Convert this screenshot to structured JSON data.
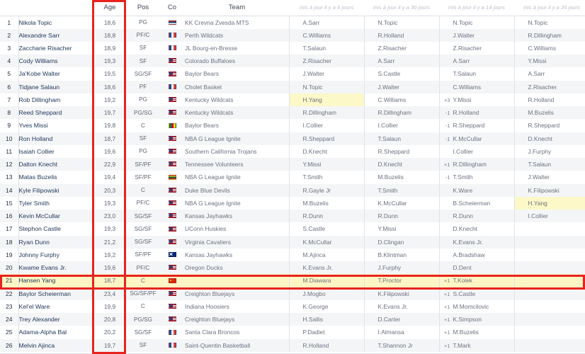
{
  "table": {
    "headers": {
      "rank": "",
      "name": "",
      "age": "Age",
      "pos": "Pos",
      "co": "Co",
      "team": "Team",
      "hist1": "mis à jour il y a 6 jours",
      "hist2": "mis à jour il y a 30 jours",
      "hist3": "mis à jour il y a 14 jours",
      "hist4": "mis à jour il y a 20 jours"
    },
    "highlight_color": "#fdf6c4",
    "annotation_color": "#e8231f",
    "rows": [
      {
        "rank": "1",
        "name": "Nikola Topic",
        "age": "18,6",
        "pos": "PG",
        "flag": "srb",
        "team": "KK Crevna Zvesda MTS",
        "h1": {
          "d": "",
          "p": "A.Sarr"
        },
        "h2": {
          "d": "",
          "p": "N.Topic"
        },
        "h3": {
          "d": "",
          "p": "N.Topic"
        },
        "h4": {
          "d": "",
          "p": "N.Topic"
        }
      },
      {
        "rank": "2",
        "name": "Alexandre Sarr",
        "age": "18,8",
        "pos": "PF/C",
        "flag": "fra",
        "team": "Perth Wildcats",
        "h1": {
          "d": "",
          "p": "C.Williams"
        },
        "h2": {
          "d": "",
          "p": "R.Holland"
        },
        "h3": {
          "d": "",
          "p": "J.Walter"
        },
        "h4": {
          "d": "",
          "p": "R.Dillingham"
        }
      },
      {
        "rank": "3",
        "name": "Zaccharie Risacher",
        "age": "18,9",
        "pos": "SF",
        "flag": "fra",
        "team": "JL Bourg-en-Bresse",
        "h1": {
          "d": "",
          "p": "T.Salaun"
        },
        "h2": {
          "d": "",
          "p": "Z.Risacher"
        },
        "h3": {
          "d": "",
          "p": "Z.Risacher"
        },
        "h4": {
          "d": "",
          "p": "C.Williams"
        }
      },
      {
        "rank": "4",
        "name": "Cody Williams",
        "age": "19,3",
        "pos": "SF",
        "flag": "usa",
        "team": "Colorado Buffaloes",
        "h1": {
          "d": "",
          "p": "Z.Risacher"
        },
        "h2": {
          "d": "",
          "p": "A.Sarr"
        },
        "h3": {
          "d": "",
          "p": "A.Sarr"
        },
        "h4": {
          "d": "",
          "p": "Y.Missi"
        }
      },
      {
        "rank": "5",
        "name": "Ja'Kobe Walter",
        "age": "19,5",
        "pos": "SG/SF",
        "flag": "usa",
        "team": "Baylor Bears",
        "h1": {
          "d": "",
          "p": "J.Walter"
        },
        "h2": {
          "d": "",
          "p": "S.Castle"
        },
        "h3": {
          "d": "",
          "p": "T.Salaun"
        },
        "h4": {
          "d": "",
          "p": "A.Sarr"
        }
      },
      {
        "rank": "6",
        "name": "Tidjane Salaun",
        "age": "18,6",
        "pos": "PF",
        "flag": "fra",
        "team": "Cholet Basket",
        "h1": {
          "d": "",
          "p": "N.Topic"
        },
        "h2": {
          "d": "",
          "p": "J.Walter"
        },
        "h3": {
          "d": "",
          "p": "C.Williams"
        },
        "h4": {
          "d": "",
          "p": "Z.Risacher"
        }
      },
      {
        "rank": "7",
        "name": "Rob Dillingham",
        "age": "19,2",
        "pos": "PG",
        "flag": "usa",
        "team": "Kentucky Wildcats",
        "h1": {
          "d": "",
          "p": "H.Yang",
          "hl": true
        },
        "h2": {
          "d": "",
          "p": "C.Williams"
        },
        "h3": {
          "d": "+3",
          "p": "Y.Missi"
        },
        "h4": {
          "d": "",
          "p": "R.Holland"
        }
      },
      {
        "rank": "8",
        "name": "Reed Sheppard",
        "age": "19,7",
        "pos": "PG/SG",
        "flag": "usa",
        "team": "Kentucky Wildcats",
        "h1": {
          "d": "",
          "p": "R.Dillingham"
        },
        "h2": {
          "d": "",
          "p": "R.Dillingham"
        },
        "h3": {
          "d": "-1",
          "p": "R.Holland"
        },
        "h4": {
          "d": "",
          "p": "M.Buzelis"
        }
      },
      {
        "rank": "9",
        "name": "Yves Missi",
        "age": "19,8",
        "pos": "C",
        "flag": "cmr",
        "team": "Baylor Bears",
        "h1": {
          "d": "",
          "p": "I.Collier"
        },
        "h2": {
          "d": "",
          "p": "I.Collier"
        },
        "h3": {
          "d": "-1",
          "p": "R.Sheppard"
        },
        "h4": {
          "d": "",
          "p": "R.Sheppard"
        }
      },
      {
        "rank": "10",
        "name": "Ron Holland",
        "age": "18,7",
        "pos": "SF",
        "flag": "usa",
        "team": "NBA G League Ignite",
        "h1": {
          "d": "",
          "p": "R.Sheppard"
        },
        "h2": {
          "d": "",
          "p": "T.Salaun"
        },
        "h3": {
          "d": "-1",
          "p": "K.McCullar"
        },
        "h4": {
          "d": "",
          "p": "D.Knecht"
        }
      },
      {
        "rank": "11",
        "name": "Isaiah Collier",
        "age": "19,6",
        "pos": "PG",
        "flag": "usa",
        "team": "Southern California Trojans",
        "h1": {
          "d": "",
          "p": "D.Knecht"
        },
        "h2": {
          "d": "",
          "p": "R.Sheppard"
        },
        "h3": {
          "d": "",
          "p": "I.Collier"
        },
        "h4": {
          "d": "",
          "p": "J.Furphy"
        }
      },
      {
        "rank": "12",
        "name": "Dalton Knecht",
        "age": "22,9",
        "pos": "SF/PF",
        "flag": "usa",
        "team": "Tennessee Volunteers",
        "h1": {
          "d": "",
          "p": "Y.Missi"
        },
        "h2": {
          "d": "",
          "p": "D.Knecht"
        },
        "h3": {
          "d": "+1",
          "p": "R.Dillingham"
        },
        "h4": {
          "d": "",
          "p": "T.Salaun"
        }
      },
      {
        "rank": "13",
        "name": "Matas Buzelis",
        "age": "19,4",
        "pos": "SF/PF",
        "flag": "ltu",
        "team": "NBA G League Ignite",
        "h1": {
          "d": "",
          "p": "T.Smith"
        },
        "h2": {
          "d": "",
          "p": "M.Buzelis"
        },
        "h3": {
          "d": "-1",
          "p": "T.Smith"
        },
        "h4": {
          "d": "",
          "p": "J.Walter"
        }
      },
      {
        "rank": "14",
        "name": "Kyle Filipowski",
        "age": "20,3",
        "pos": "C",
        "flag": "usa",
        "team": "Duke Blue Devils",
        "h1": {
          "d": "",
          "p": "R.Gayle Jr"
        },
        "h2": {
          "d": "",
          "p": "T.Smith"
        },
        "h3": {
          "d": "",
          "p": "K.Ware"
        },
        "h4": {
          "d": "",
          "p": "K.Filipowski"
        }
      },
      {
        "rank": "15",
        "name": "Tyler Smith",
        "age": "19,3",
        "pos": "PF/C",
        "flag": "usa",
        "team": "NBA G League Ignite",
        "h1": {
          "d": "",
          "p": "M.Buzelis"
        },
        "h2": {
          "d": "",
          "p": "K.McCullar"
        },
        "h3": {
          "d": "",
          "p": "B.Scheierman"
        },
        "h4": {
          "d": "",
          "p": "H.Yang",
          "hl": true
        }
      },
      {
        "rank": "16",
        "name": "Kevin McCullar",
        "age": "23,0",
        "pos": "SG/SF",
        "flag": "usa",
        "team": "Kansas Jayhawks",
        "h1": {
          "d": "",
          "p": "R.Dunn"
        },
        "h2": {
          "d": "",
          "p": "R.Dunn"
        },
        "h3": {
          "d": "",
          "p": "R.Dunn"
        },
        "h4": {
          "d": "",
          "p": "I.Collier"
        }
      },
      {
        "rank": "17",
        "name": "Stephon Castle",
        "age": "19,3",
        "pos": "SG/SF",
        "flag": "usa",
        "team": "UConn Huskies",
        "h1": {
          "d": "",
          "p": "S.Castle"
        },
        "h2": {
          "d": "",
          "p": "Y.Missi"
        },
        "h3": {
          "d": "",
          "p": "D.Knecht"
        },
        "h4": {
          "d": "",
          "p": ""
        }
      },
      {
        "rank": "18",
        "name": "Ryan Dunn",
        "age": "21,2",
        "pos": "SG/SF",
        "flag": "usa",
        "team": "Virginia Cavaliers",
        "h1": {
          "d": "",
          "p": "K.McCullar"
        },
        "h2": {
          "d": "",
          "p": "D.Clingan"
        },
        "h3": {
          "d": "",
          "p": "K.Evans Jr."
        },
        "h4": {
          "d": "",
          "p": ""
        }
      },
      {
        "rank": "19",
        "name": "Johnny Furphy",
        "age": "19,2",
        "pos": "SF/PF",
        "flag": "aus",
        "team": "Kansas Jayhawks",
        "h1": {
          "d": "",
          "p": "M.Ajinca"
        },
        "h2": {
          "d": "",
          "p": "B.Klintman"
        },
        "h3": {
          "d": "",
          "p": "A.Bradshaw"
        },
        "h4": {
          "d": "",
          "p": ""
        }
      },
      {
        "rank": "20",
        "name": "Kwame Evans Jr.",
        "age": "19,6",
        "pos": "PF/C",
        "flag": "usa",
        "team": "Oregon Ducks",
        "h1": {
          "d": "",
          "p": "K.Evans Jr."
        },
        "h2": {
          "d": "",
          "p": "J.Furphy"
        },
        "h3": {
          "d": "",
          "p": "D.Dent"
        },
        "h4": {
          "d": "",
          "p": ""
        }
      },
      {
        "rank": "21",
        "name": "Hansen Yang",
        "age": "18,7",
        "pos": "C",
        "flag": "chn",
        "team": "",
        "h1": {
          "d": "",
          "p": "M.Diawara"
        },
        "h2": {
          "d": "",
          "p": "T.Proctor"
        },
        "h3": {
          "d": "+1",
          "p": "T.Kolek"
        },
        "h4": {
          "d": "",
          "p": ""
        },
        "highlight": true
      },
      {
        "rank": "22",
        "name": "Baylor Scheierman",
        "age": "23,4",
        "pos": "SG/SF/PF",
        "flag": "usa",
        "team": "Creighton Bluejays",
        "h1": {
          "d": "",
          "p": "J.Mogbo"
        },
        "h2": {
          "d": "",
          "p": "K.Filipowski"
        },
        "h3": {
          "d": "+1",
          "p": "S.Castle"
        },
        "h4": {
          "d": "",
          "p": ""
        }
      },
      {
        "rank": "23",
        "name": "Kel'el Ware",
        "age": "19,9",
        "pos": "C",
        "flag": "usa",
        "team": "Indiana Hoosiers",
        "h1": {
          "d": "",
          "p": "K.George"
        },
        "h2": {
          "d": "",
          "p": "K.Evans Jr."
        },
        "h3": {
          "d": "+1",
          "p": "M.Momcilovic"
        },
        "h4": {
          "d": "",
          "p": ""
        }
      },
      {
        "rank": "24",
        "name": "Trey Alexander",
        "age": "20,8",
        "pos": "PG/SG",
        "flag": "usa",
        "team": "Creighton Bluejays",
        "h1": {
          "d": "",
          "p": "H.Sallis"
        },
        "h2": {
          "d": "",
          "p": "D.Carter"
        },
        "h3": {
          "d": "+1",
          "p": "K.Simpson"
        },
        "h4": {
          "d": "",
          "p": ""
        }
      },
      {
        "rank": "25",
        "name": "Adama-Alpha Bal",
        "age": "20,2",
        "pos": "SG/SF",
        "flag": "fra",
        "team": "Santa Clara Broncos",
        "h1": {
          "d": "",
          "p": "P.Dadiet"
        },
        "h2": {
          "d": "",
          "p": "I.Almansa"
        },
        "h3": {
          "d": "+1",
          "p": "M.Buzelis"
        },
        "h4": {
          "d": "",
          "p": ""
        }
      },
      {
        "rank": "26",
        "name": "Melvin Ajinca",
        "age": "19,7",
        "pos": "SF",
        "flag": "fra",
        "team": "Saint-Quentin Basketball",
        "h1": {
          "d": "",
          "p": "R.Holland"
        },
        "h2": {
          "d": "",
          "p": "T.Shannon Jr"
        },
        "h3": {
          "d": "+1",
          "p": "T.Mark"
        },
        "h4": {
          "d": "",
          "p": ""
        }
      }
    ]
  }
}
